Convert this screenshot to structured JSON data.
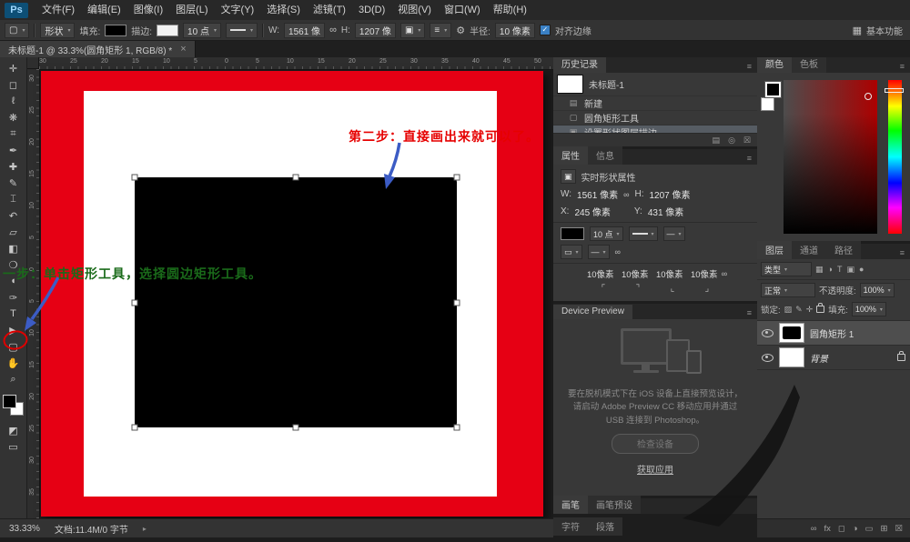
{
  "app": {
    "logo": "Ps"
  },
  "colors": {
    "document_red": "#e60014",
    "step1_text_green": "#1a6b1a",
    "step2_text_red": "#e60000",
    "arrow_blue": "#3c5cc5",
    "annotation_circle_red": "#dd0000",
    "ui_panel_gray": "#383838"
  },
  "icons": {
    "chevron": "▾",
    "link": "∞",
    "gear": "⚙",
    "boolean_ops": "▣",
    "path_align": "≡",
    "workspace_grid": "▦",
    "panel_menu": "≡",
    "status_chevron": "▸",
    "check": "✓",
    "tool_preset": "▢",
    "live_shape": "▣"
  },
  "menubar": {
    "items": [
      "文件(F)",
      "编辑(E)",
      "图像(I)",
      "图层(L)",
      "文字(Y)",
      "选择(S)",
      "滤镜(T)",
      "3D(D)",
      "视图(V)",
      "窗口(W)",
      "帮助(H)"
    ]
  },
  "options_bar": {
    "tool_mode": "形状",
    "fill_label": "填充:",
    "stroke_label": "描边:",
    "stroke_width": "10 点",
    "w_label": "W:",
    "w_value": "1561 像",
    "h_label": "H:",
    "h_value": "1207 像",
    "radius_label": "半径:",
    "radius_value": "10 像素",
    "align_edges_label": "对齐边缘",
    "workspace": "基本功能"
  },
  "document_tab": {
    "title": "未标题-1 @ 33.3%(圆角矩形 1, RGB/8) *",
    "close_glyph": "×"
  },
  "toolbar": {
    "tools": [
      {
        "name": "move-tool",
        "glyph": "✛"
      },
      {
        "name": "marquee-tool",
        "glyph": "◻"
      },
      {
        "name": "lasso-tool",
        "glyph": "ℓ"
      },
      {
        "name": "quick-selection-tool",
        "glyph": "❋"
      },
      {
        "name": "crop-tool",
        "glyph": "⌗"
      },
      {
        "name": "eyedropper-tool",
        "glyph": "✒"
      },
      {
        "name": "healing-brush-tool",
        "glyph": "✚"
      },
      {
        "name": "brush-tool",
        "glyph": "✎"
      },
      {
        "name": "clone-stamp-tool",
        "glyph": "⌶"
      },
      {
        "name": "history-brush-tool",
        "glyph": "↶"
      },
      {
        "name": "eraser-tool",
        "glyph": "▱"
      },
      {
        "name": "gradient-tool",
        "glyph": "◧"
      },
      {
        "name": "blur-tool",
        "glyph": "❍"
      },
      {
        "name": "dodge-tool",
        "glyph": "◖"
      },
      {
        "name": "pen-tool",
        "glyph": "✑"
      },
      {
        "name": "type-tool",
        "glyph": "T"
      },
      {
        "name": "path-selection-tool",
        "glyph": "▶"
      },
      {
        "name": "rounded-rectangle-tool",
        "glyph": "▢"
      },
      {
        "name": "hand-tool",
        "glyph": "✋"
      },
      {
        "name": "zoom-tool",
        "glyph": "⌕"
      }
    ],
    "bottom_icons": [
      {
        "name": "quick-mask-icon",
        "glyph": "◩"
      },
      {
        "name": "screen-mode-icon",
        "glyph": "▭"
      }
    ]
  },
  "rulers": {
    "top": [
      "30",
      "25",
      "20",
      "15",
      "10",
      "5",
      "0",
      "5",
      "10",
      "15",
      "20",
      "25",
      "30",
      "35",
      "40",
      "45",
      "50"
    ],
    "left": [
      "30",
      "25",
      "20",
      "15",
      "10",
      "5",
      "0",
      "5",
      "10",
      "15",
      "20",
      "25",
      "30",
      "35"
    ]
  },
  "annotations": {
    "step2_text": "第二步：直接画出来就可以了。",
    "step1_text": "一步：单击矩形工具，选择圆边矩形工具。"
  },
  "history_panel": {
    "title": "历史记录",
    "snapshot_label": "未标题-1",
    "items": [
      {
        "glyph": "▤",
        "label": "新建"
      },
      {
        "glyph": "▢",
        "label": "圆角矩形工具"
      },
      {
        "glyph": "▣",
        "label": "设置形状图层描边",
        "selected": true
      }
    ],
    "footer_icons": [
      {
        "name": "new-doc-from-state-icon",
        "glyph": "▤"
      },
      {
        "name": "new-snapshot-icon",
        "glyph": "◎"
      },
      {
        "name": "delete-state-icon",
        "glyph": "☒"
      }
    ]
  },
  "properties_panel": {
    "tab_properties": "属性",
    "tab_info": "信息",
    "header": "实时形状属性",
    "w_label": "W:",
    "w_value": "1561 像素",
    "h_label": "H:",
    "h_value": "1207 像素",
    "x_label": "X:",
    "x_value": "245 像素",
    "y_label": "Y:",
    "y_value": "431 像素",
    "stroke_width": "10 点",
    "radii": [
      "10像素",
      "10像素",
      "10像素",
      "10像素"
    ],
    "corner_icons": [
      {
        "name": "corner-top-left-icon",
        "glyph": "⌜"
      },
      {
        "name": "corner-top-right-icon",
        "glyph": "⌝"
      },
      {
        "name": "corner-bottom-left-icon",
        "glyph": "⌞"
      },
      {
        "name": "corner-bottom-right-icon",
        "glyph": "⌟"
      }
    ]
  },
  "device_preview_panel": {
    "title": "Device Preview",
    "body_text": "要在脱机模式下在 iOS 设备上直接预览设计，请启动 Adobe Preview CC 移动应用并通过 USB 连接到 Photoshop。",
    "check_device_button": "检查设备",
    "get_app_link": "获取应用"
  },
  "bottom_tabs": {
    "brush": "画笔",
    "brush_presets": "画笔预设",
    "character": "字符",
    "paragraph": "段落"
  },
  "color_panel": {
    "tab_color": "颜色",
    "tab_swatches": "色板"
  },
  "layers_panel": {
    "tab_layers": "图层",
    "tab_channels": "通道",
    "tab_paths": "路径",
    "filter_label": "类型",
    "filter_icons": [
      {
        "name": "pixel-layer-filter-icon",
        "glyph": "▦"
      },
      {
        "name": "adjustment-layer-filter-icon",
        "glyph": "◑"
      },
      {
        "name": "type-layer-filter-icon",
        "glyph": "T"
      },
      {
        "name": "shape-layer-filter-icon",
        "glyph": "▣"
      },
      {
        "name": "smart-object-filter-icon",
        "glyph": "●"
      }
    ],
    "blend_mode": "正常",
    "opacity_label": "不透明度:",
    "opacity_value": "100%",
    "lock_label": "锁定:",
    "lock_icons": [
      {
        "name": "lock-transparency-icon",
        "glyph": "▨"
      },
      {
        "name": "lock-pixels-icon",
        "glyph": "✎"
      },
      {
        "name": "lock-position-icon",
        "glyph": "✛"
      }
    ],
    "fill_label": "填充:",
    "fill_value": "100%",
    "layers": [
      {
        "name": "圆角矩形 1"
      },
      {
        "name": "背景"
      }
    ],
    "footer_icons": [
      {
        "name": "link-layers-icon",
        "glyph": "∞"
      },
      {
        "name": "layer-style-icon",
        "glyph": "fx"
      },
      {
        "name": "add-mask-icon",
        "glyph": "◻"
      },
      {
        "name": "adjustment-layer-icon",
        "glyph": "◑"
      },
      {
        "name": "new-group-icon",
        "glyph": "▭"
      },
      {
        "name": "new-layer-icon",
        "glyph": "⊞"
      },
      {
        "name": "delete-layer-icon",
        "glyph": "☒"
      }
    ]
  },
  "status_bar": {
    "zoom": "33.33%",
    "doc_info": "文档:11.4M/0 字节"
  }
}
